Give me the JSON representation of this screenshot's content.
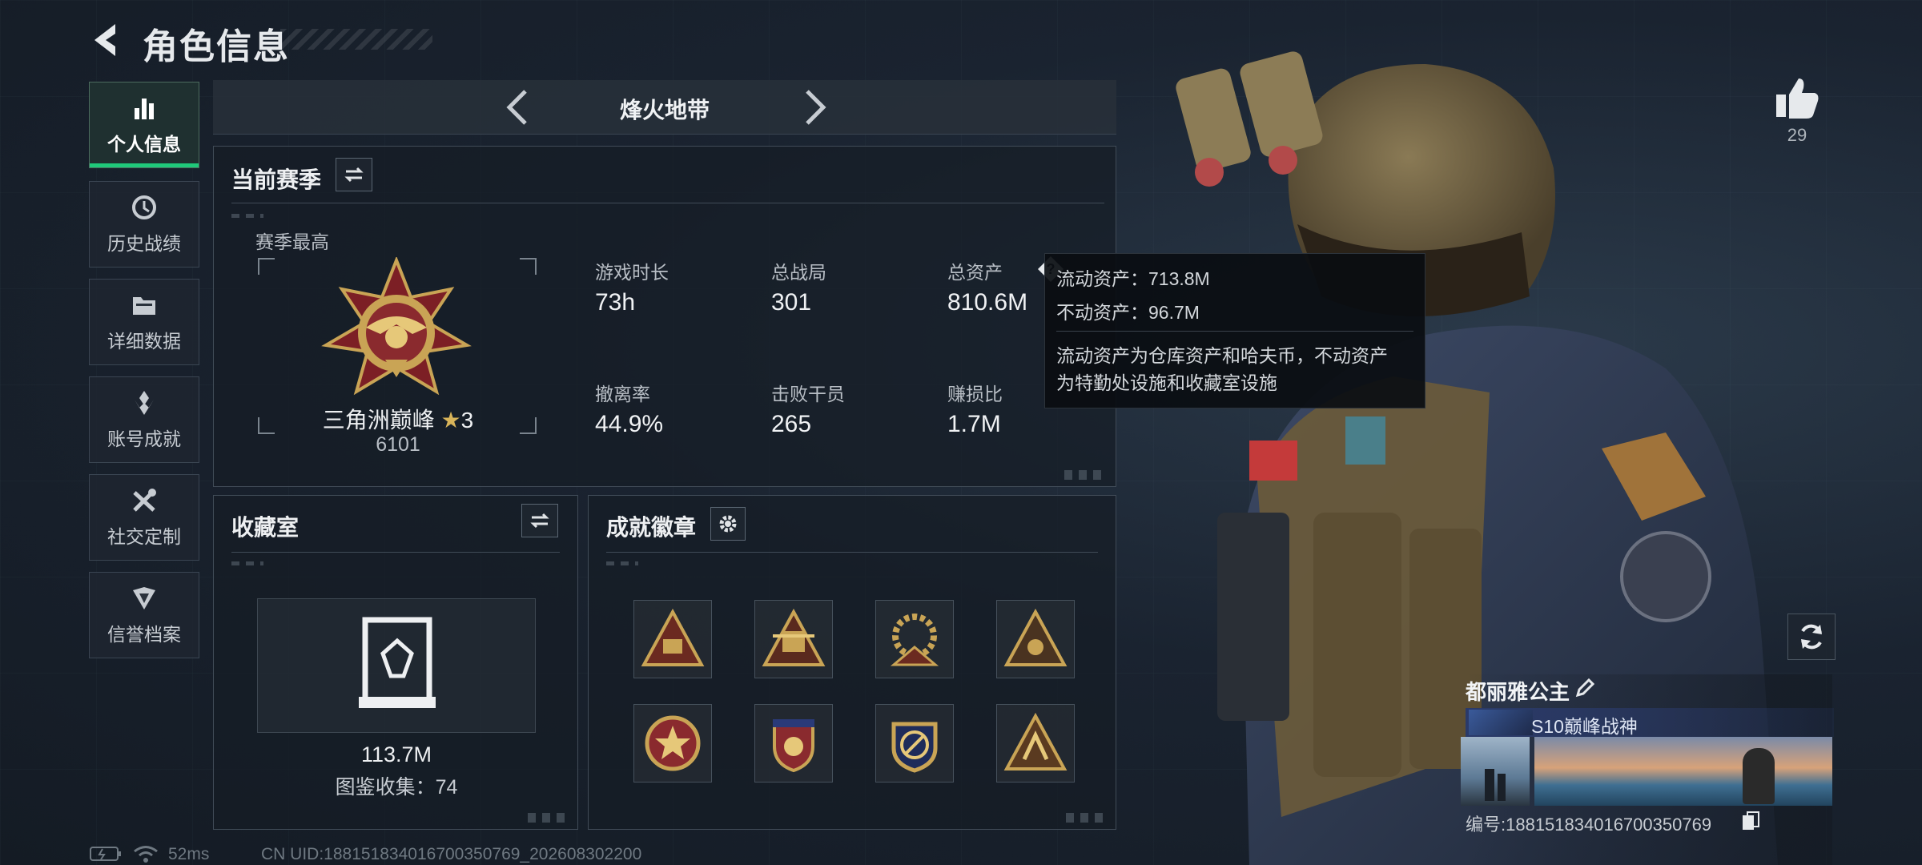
{
  "header": {
    "title": "角色信息"
  },
  "nav": {
    "items": [
      {
        "label": "个人信息",
        "icon": "bar-chart-icon",
        "active": true
      },
      {
        "label": "历史战绩",
        "icon": "history-clock-icon",
        "active": false
      },
      {
        "label": "详细数据",
        "icon": "folder-icon",
        "active": false
      },
      {
        "label": "账号成就",
        "icon": "achievement-icon",
        "active": false
      },
      {
        "label": "社交定制",
        "icon": "tools-icon",
        "active": false
      },
      {
        "label": "信誉档案",
        "icon": "reputation-icon",
        "active": false
      }
    ]
  },
  "mode": {
    "title": "烽火地带"
  },
  "season": {
    "title": "当前赛季",
    "best_label": "赛季最高",
    "rank_name": "三角洲巅峰",
    "rank_stars": "3",
    "rank_points": "6101",
    "stats": [
      {
        "label": "游戏时长",
        "value": "73h"
      },
      {
        "label": "总战局",
        "value": "301"
      },
      {
        "label": "总资产",
        "value": "810.6M"
      },
      {
        "label": "撤离率",
        "value": "44.9%"
      },
      {
        "label": "击败干员",
        "value": "265"
      },
      {
        "label": "赚损比",
        "value": "1.7M"
      }
    ]
  },
  "tooltip": {
    "line1": "流动资产：713.8M",
    "line2": "不动资产：96.7M",
    "desc1": "流动资产为仓库资产和哈夫币，不动资产",
    "desc2": "为特勤处设施和收藏室设施"
  },
  "collection": {
    "title": "收藏室",
    "value": "113.7M",
    "catalog": "图鉴收集：74"
  },
  "badges": {
    "title": "成就徽章",
    "items": [
      "triangle-badge-sb",
      "triangle-badge-sb-2",
      "gear-badge-s10",
      "triangle-badge-4",
      "star-round-badge",
      "shield-crest-badge",
      "round-emblem-badge",
      "triangle-badge-8"
    ]
  },
  "profile": {
    "likes": "29",
    "name": "都丽雅公主",
    "title": "S10巅峰战神",
    "id_text": "编号:1881518340167003507​69"
  },
  "status": {
    "ping": "52ms",
    "uid": "CN UID:188151834016700350769_202608302200"
  },
  "colors": {
    "accent_green": "#1fc97a",
    "gold": "#c9a455",
    "panel_border": "#404b57"
  }
}
